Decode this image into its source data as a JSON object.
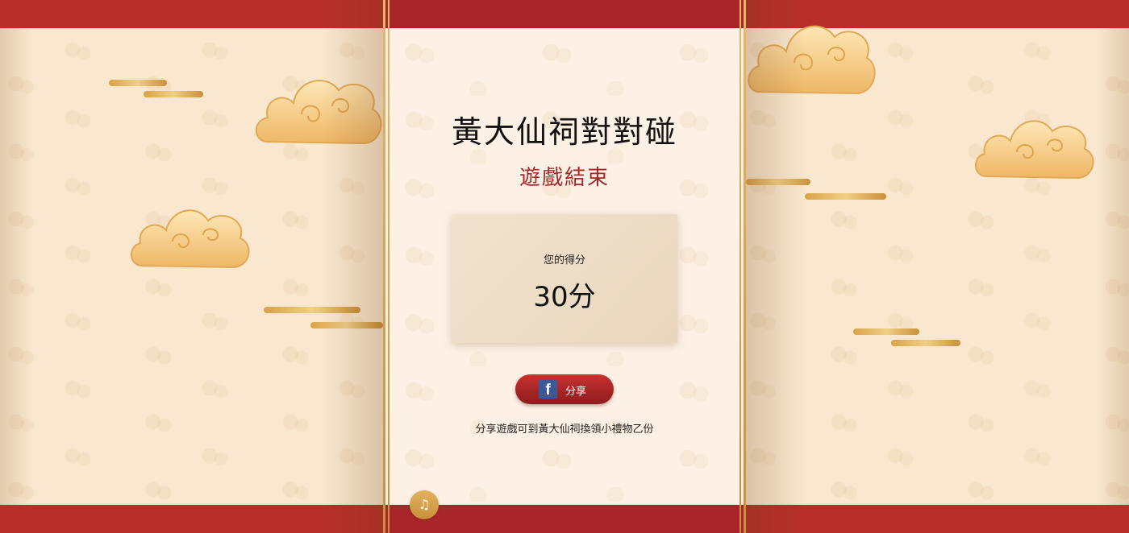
{
  "game": {
    "title": "黃大仙祠對對碰",
    "status": "遊戲結束"
  },
  "score": {
    "label": "您的得分",
    "value": "30分"
  },
  "share": {
    "icon_label": "f",
    "label": "分享",
    "note": "分享遊戲可到黃大仙祠換領小禮物乙份"
  },
  "music": {
    "icon": "music-note-icon",
    "glyph": "♫"
  },
  "colors": {
    "background": "#f9e8cf",
    "band_red": "#b72e2b",
    "panel": "#fdf1e6",
    "accent_gold": "#d9a247",
    "status_red": "#a8262a",
    "facebook_blue": "#3b5998"
  }
}
